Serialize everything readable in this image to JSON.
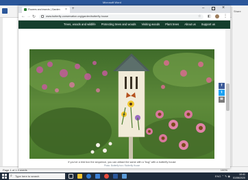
{
  "word": {
    "title": "Microsoft Word",
    "right_pane_label": "Share",
    "status_left": "Page 1 of 1   0 words",
    "status_right": "100%"
  },
  "browser": {
    "tab_title": "Flowers and insects | Garden",
    "url": "www.butterfly-conservation.org/garden/butterfly-house",
    "new_tab": "+",
    "tab_close": "×"
  },
  "site_nav": {
    "items": [
      "Trees, woods and wildlife",
      "Protecting trees and woods",
      "Visiting woods",
      "Plant trees",
      "About us",
      "Support us"
    ]
  },
  "hero": {
    "caption": "If you’ve a bird box the sequence, you can attract the same with a “bug” with a butterfly house",
    "credit": "Photo: Butterfly box / Butterfly House"
  },
  "share": {
    "facebook": "f",
    "twitter": "t",
    "email": "✉"
  },
  "taskbar": {
    "search_placeholder": "Type here to search",
    "time": "10:41",
    "date": "01/06/2020",
    "tray": "ENG ⌃ ✎ ◉"
  }
}
